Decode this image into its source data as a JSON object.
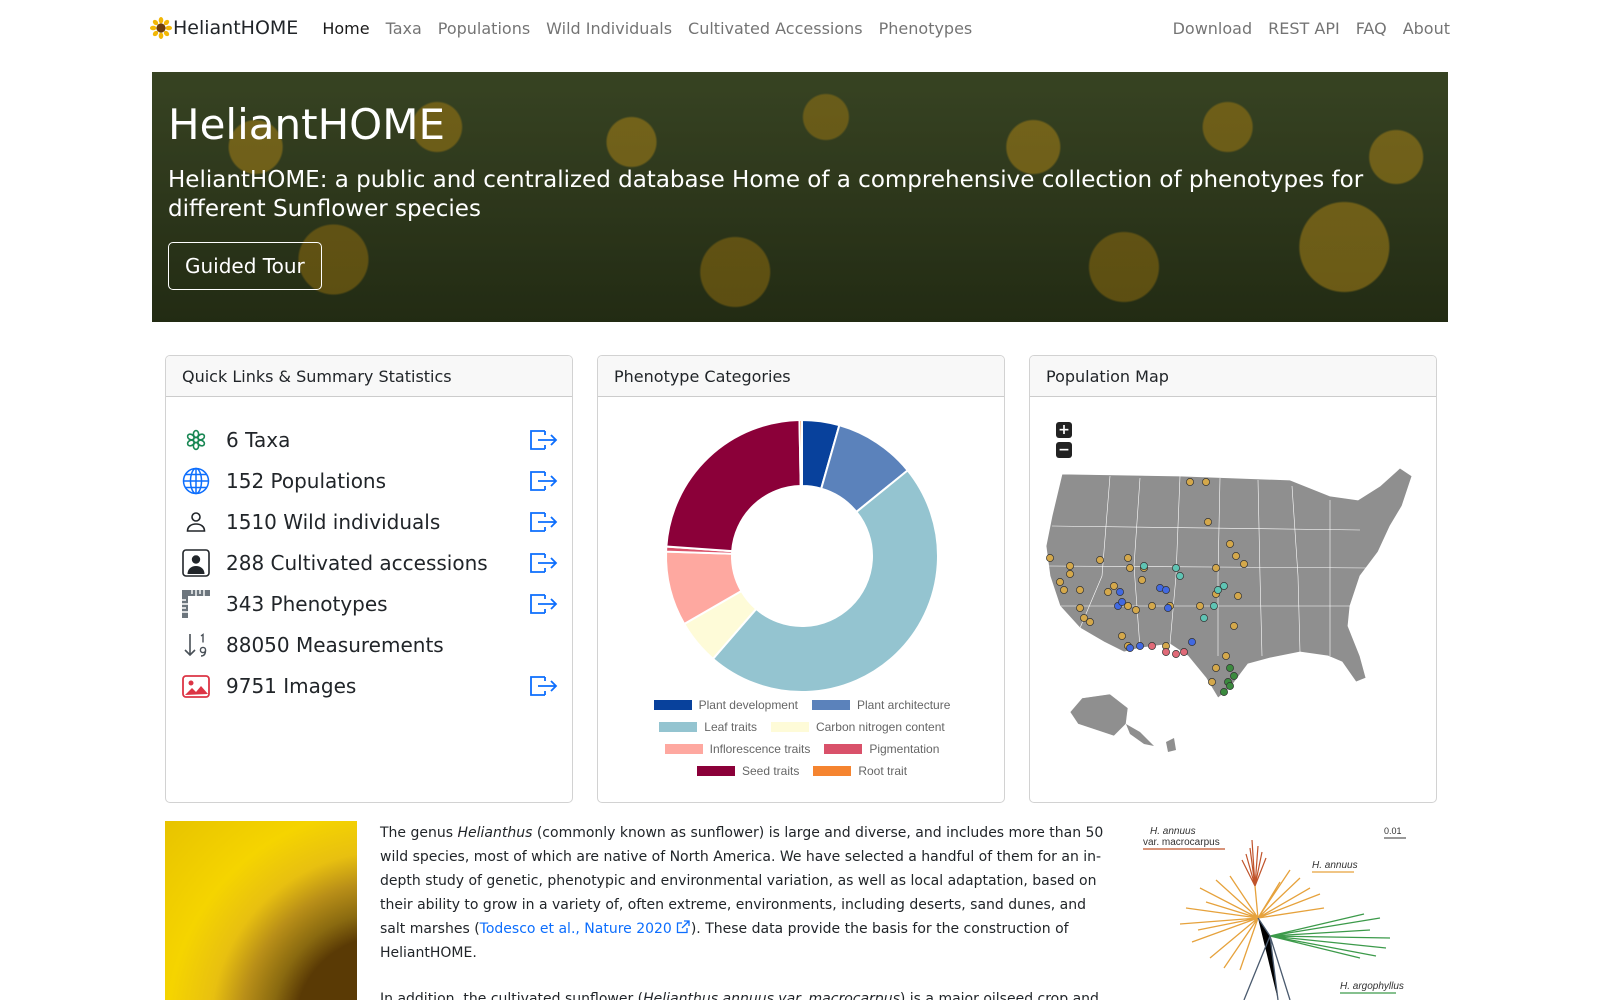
{
  "navbar": {
    "brand": "HeliantHOME",
    "links": [
      "Home",
      "Taxa",
      "Populations",
      "Wild Individuals",
      "Cultivated Accessions",
      "Phenotypes"
    ],
    "right_links": [
      "Download",
      "REST API",
      "FAQ",
      "About"
    ]
  },
  "hero": {
    "title": "HeliantHOME",
    "subtitle": "HeliantHOME: a public and centralized database Home of a comprehensive collection of phenotypes for different Sunflower species",
    "button": "Guided Tour"
  },
  "quick_links": {
    "header": "Quick Links & Summary Statistics",
    "items": [
      {
        "text": "6 Taxa",
        "icon": "flower-icon"
      },
      {
        "text": "152 Populations",
        "icon": "globe-icon"
      },
      {
        "text": "1510 Wild individuals",
        "icon": "person-icon"
      },
      {
        "text": "288 Cultivated accessions",
        "icon": "person-square-icon"
      },
      {
        "text": "343 Phenotypes",
        "icon": "ruler-icon"
      },
      {
        "text": "88050 Measurements",
        "icon": "sort-numeric-icon"
      },
      {
        "text": "9751 Images",
        "icon": "images-icon"
      }
    ]
  },
  "phenotype_card": {
    "header": "Phenotype Categories"
  },
  "chart_data": {
    "type": "pie",
    "donut": true,
    "categories": [
      "Plant development",
      "Plant architecture",
      "Leaf traits",
      "Carbon nitrogen content",
      "Inflorescence traits",
      "Pigmentation",
      "Seed traits",
      "Root trait"
    ],
    "values": [
      15,
      33,
      160,
      18,
      30,
      2,
      80,
      1
    ],
    "colors": [
      "#08419c",
      "#5b82bb",
      "#94c4d0",
      "#fefbd8",
      "#fea8a0",
      "#d9516a",
      "#8b0039",
      "#f58430"
    ],
    "legend_position": "bottom"
  },
  "map_card": {
    "header": "Population Map",
    "zoom_in": "+",
    "zoom_out": "−"
  },
  "about": {
    "p1_a": "The genus ",
    "p1_em": "Helianthus",
    "p1_b": " (commonly known as sunflower) is large and diverse, and includes more than 50 wild species, most of which are native of North America. We have selected a handful of them for an in-depth study of genetic, phenotypic and environmental variation, as well as local adaptation, based on their ability to grow in a variety of, often extreme, environments, including deserts, sand dunes, and salt marshes (",
    "p1_link": "Todesco et al., Nature 2020",
    "p1_c": "). These data provide the basis for the construction of HeliantHOME.",
    "p2_a": "In addition, the cultivated sunflower (",
    "p2_em": "Helianthus annuus var. macrocarpus",
    "p2_b": ") is a major oilseed crop and"
  },
  "tree": {
    "labels": [
      "H. annuus",
      "var. macrocarpus",
      "H. annuus",
      "H. argophyllus"
    ],
    "scale": "0.01"
  }
}
